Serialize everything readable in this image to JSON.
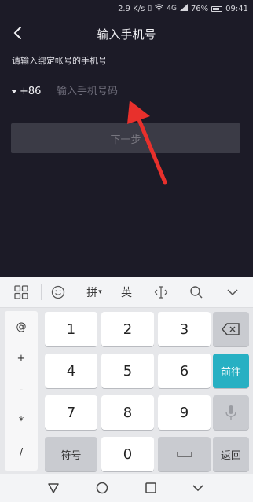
{
  "status": {
    "speed": "2.9 K/s",
    "network": "4G",
    "battery": "76%",
    "time": "09:41"
  },
  "header": {
    "title": "输入手机号"
  },
  "hint": "请输入绑定帐号的手机号",
  "phone": {
    "country_code": "+86",
    "placeholder": "输入手机号码",
    "value": ""
  },
  "next_button": "下一步",
  "keyboard": {
    "toolbar": {
      "pinyin": "拼",
      "english": "英"
    },
    "symbols": [
      "@",
      "+",
      "-",
      "*",
      "/"
    ],
    "keys": [
      "1",
      "2",
      "3",
      "4",
      "5",
      "6",
      "7",
      "8",
      "9",
      "0"
    ],
    "symbol_key": "符号",
    "enter": "前往",
    "back": "返回"
  }
}
